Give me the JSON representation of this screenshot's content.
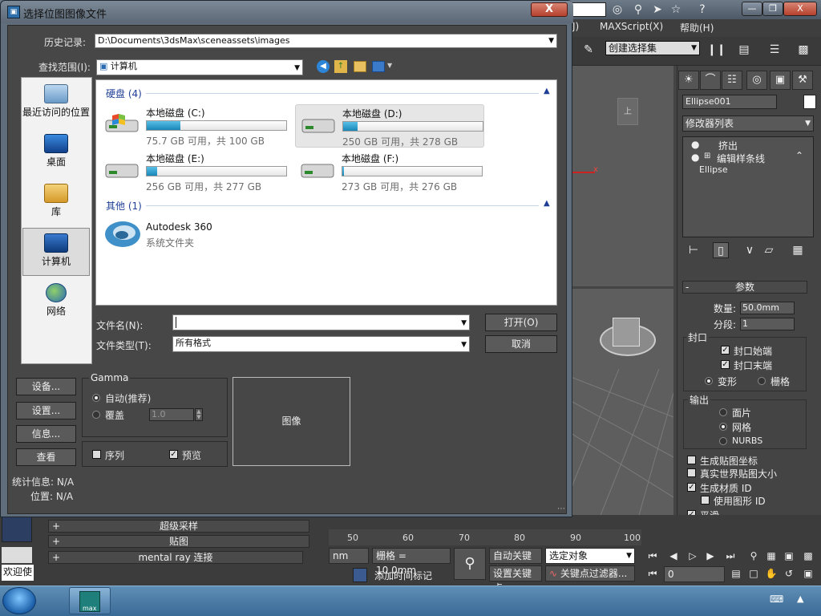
{
  "dialog": {
    "title": "选择位图图像文件",
    "close_label": "X",
    "history_label": "历史记录:",
    "history_path": "D:\\Documents\\3dsMax\\sceneassets\\images",
    "lookin_label": "查找范围(I):",
    "lookin_value": "计算机",
    "places": [
      {
        "label": "最近访问的位置",
        "icon": "recent-places-icon"
      },
      {
        "label": "桌面",
        "icon": "desktop-icon"
      },
      {
        "label": "库",
        "icon": "libraries-icon"
      },
      {
        "label": "计算机",
        "icon": "computer-icon",
        "selected": true
      },
      {
        "label": "网络",
        "icon": "network-icon"
      }
    ],
    "group_drives": "硬盘 (4)",
    "group_other": "其他 (1)",
    "drives": [
      {
        "name": "本地磁盘 (C:)",
        "free": "75.7 GB 可用，共 100 GB",
        "used_fraction": 0.243
      },
      {
        "name": "本地磁盘 (D:)",
        "free": "250 GB 可用，共 278 GB",
        "used_fraction": 0.101,
        "selected": true
      },
      {
        "name": "本地磁盘 (E:)",
        "free": "256 GB 可用，共 277 GB",
        "used_fraction": 0.076
      },
      {
        "name": "本地磁盘 (F:)",
        "free": "273 GB 可用，共 276 GB",
        "used_fraction": 0.011
      }
    ],
    "other_item": {
      "name": "Autodesk 360",
      "type": "系统文件夹"
    },
    "filename_label": "文件名(N):",
    "filename_value": "",
    "filetype_label": "文件类型(T):",
    "filetype_value": "所有格式",
    "open_label": "打开(O)",
    "cancel_label": "取消",
    "setup_label": "设备...",
    "settings_label": "设置...",
    "info_label": "信息...",
    "view_label": "查看",
    "gamma_title": "Gamma",
    "gamma_auto": "自动(推荐)",
    "gamma_override": "覆盖",
    "gamma_value": "1.0",
    "sequence_label": "序列",
    "preview_label": "预览",
    "preview_text": "图像",
    "stats_label": "统计信息: N/A",
    "location_label": "位置: N/A"
  },
  "max": {
    "menu": [
      "J)",
      "MAXScript(X)",
      "帮助(H)"
    ],
    "selection_set": "创建选择集",
    "object_name": "Ellipse001",
    "modifier_list": "修改器列表",
    "stack": [
      "挤出",
      "编辑样条线",
      "Ellipse"
    ],
    "params_title": "参数",
    "amount_label": "数量:",
    "amount_value": "50.0mm",
    "segments_label": "分段:",
    "segments_value": "1",
    "capping_title": "封口",
    "cap_start": "封口始端",
    "cap_end": "封口末端",
    "morph": "变形",
    "grid": "栅格",
    "output_title": "输出",
    "out_patch": "面片",
    "out_mesh": "网格",
    "out_nurbs": "NURBS",
    "gen_mapping": "生成贴图坐标",
    "real_world": "真实世界贴图大小",
    "gen_matid": "生成材质 ID",
    "use_shape_id": "使用图形 ID",
    "smooth": "平滑",
    "rollouts_bottom": [
      "超级采样",
      "贴图",
      "mental ray 连接"
    ],
    "viewport_label_x": "x",
    "timeline_ticks": [
      "50",
      "60",
      "70",
      "80",
      "90",
      "100"
    ],
    "grid_spacing": "栅格 = 10.0mm",
    "unit_frag": "nm",
    "auto_key": "自动关键点",
    "set_key": "设置关键点",
    "selected_obj": "选定对象",
    "key_filter": "关键点过滤器...",
    "add_time_tag": "添加时间标记",
    "frame_value": "0",
    "welcome": "欢迎使"
  },
  "taskbar": {
    "app_label": "max"
  }
}
